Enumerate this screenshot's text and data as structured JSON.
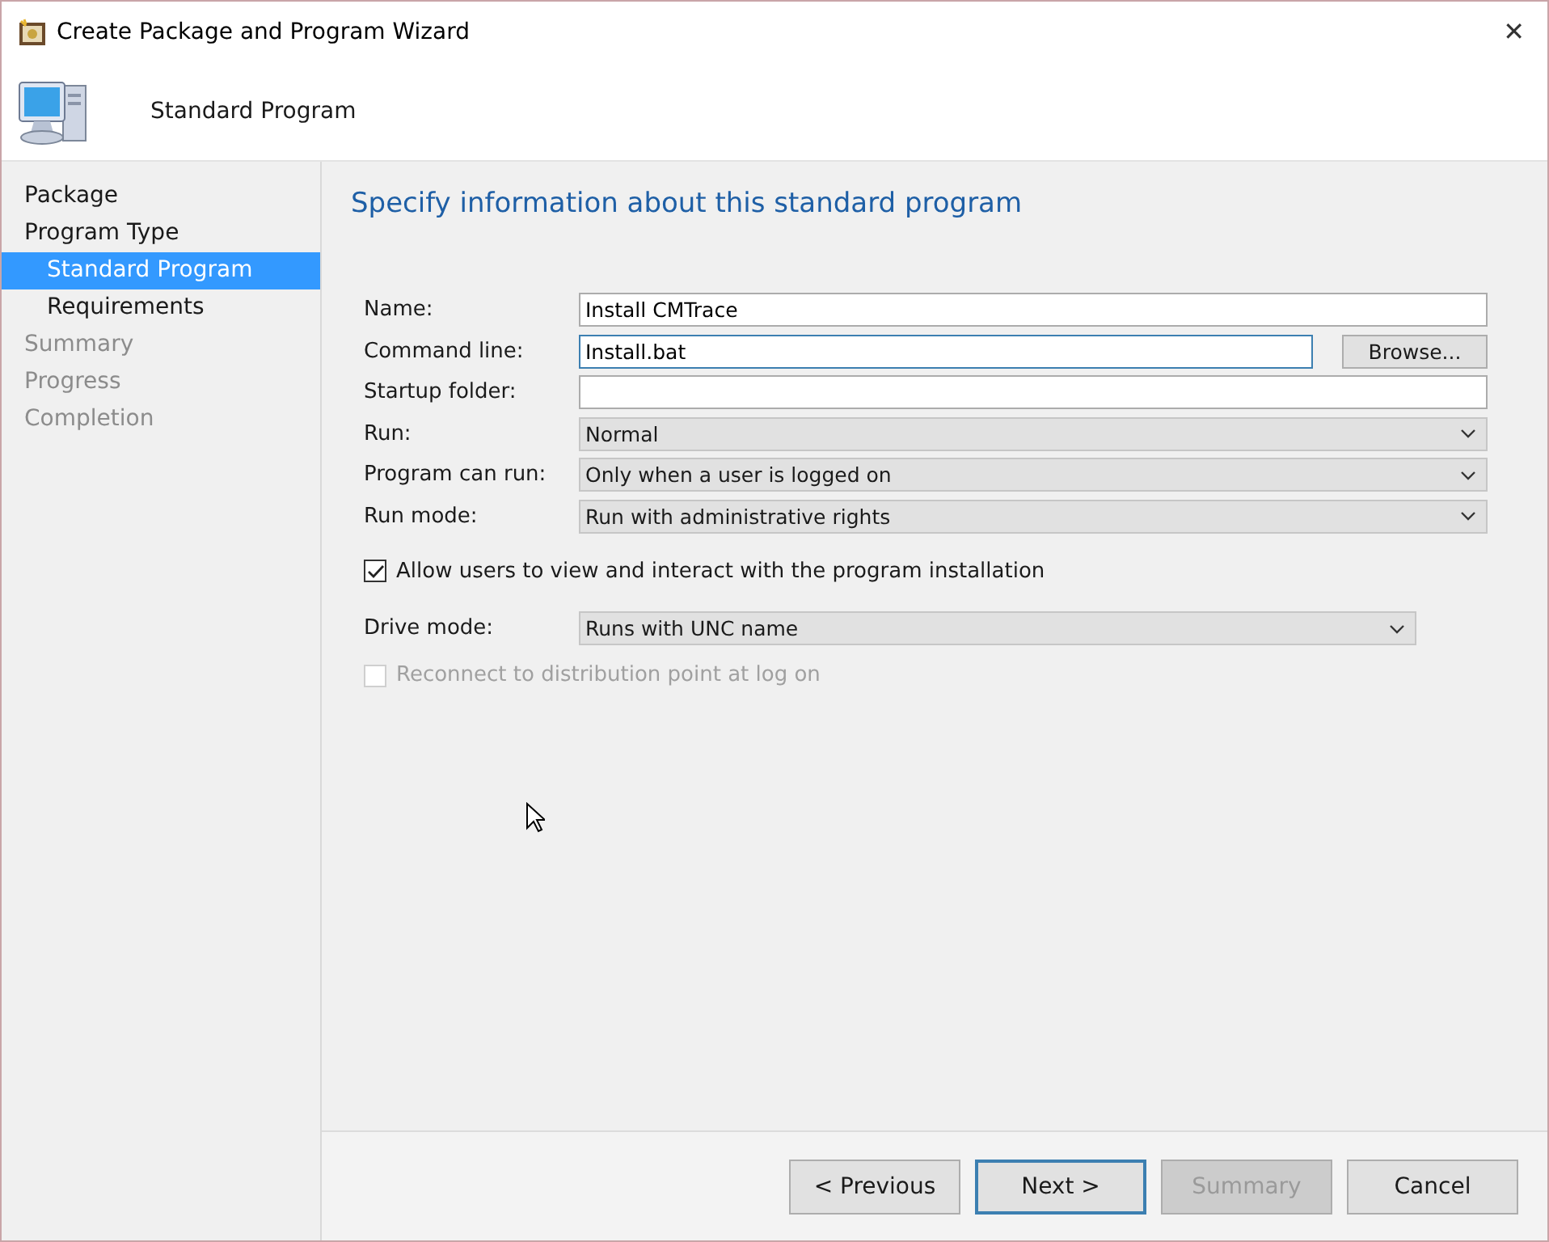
{
  "window": {
    "title": "Create Package and Program Wizard",
    "close": "✕"
  },
  "header": {
    "title": "Standard Program"
  },
  "sidebar": {
    "items": [
      {
        "label": "Package",
        "selected": false,
        "disabled": false
      },
      {
        "label": "Program Type",
        "selected": false,
        "disabled": false,
        "children": [
          {
            "label": "Standard Program",
            "selected": true,
            "disabled": false
          },
          {
            "label": "Requirements",
            "selected": false,
            "disabled": false
          }
        ]
      },
      {
        "label": "Summary",
        "selected": false,
        "disabled": true
      },
      {
        "label": "Progress",
        "selected": false,
        "disabled": true
      },
      {
        "label": "Completion",
        "selected": false,
        "disabled": true
      }
    ]
  },
  "page": {
    "heading": "Specify information about this standard program",
    "fields": [
      {
        "kind": "text",
        "label": "Name:",
        "value": "Install CMTrace",
        "focused": false
      },
      {
        "kind": "text",
        "label": "Command line:",
        "value": "Install.bat",
        "focused": true,
        "button": "Browse..."
      },
      {
        "kind": "text",
        "label": "Startup folder:",
        "focused": false
      },
      {
        "kind": "combo",
        "label": "Run:",
        "value": "Normal"
      },
      {
        "kind": "combo",
        "label": "Program can run:",
        "value": "Only when a user is logged on"
      },
      {
        "kind": "combo",
        "label": "Run mode:",
        "value": "Run with administrative rights"
      }
    ],
    "allow_interact": {
      "label": "Allow users to view and interact with the program installation",
      "checked": true,
      "disabled": false
    },
    "drive_mode": {
      "label": "Drive mode:",
      "value": "Runs with UNC name"
    },
    "reconnect": {
      "label": "Reconnect to distribution point at log on",
      "checked": false,
      "disabled": true
    }
  },
  "buttons": [
    {
      "label": "< Previous",
      "default": false,
      "disabled": false
    },
    {
      "label": "Next >",
      "default": true,
      "disabled": false
    },
    {
      "label": "Summary",
      "default": false,
      "disabled": true
    },
    {
      "label": "Cancel",
      "default": false,
      "disabled": false
    }
  ]
}
